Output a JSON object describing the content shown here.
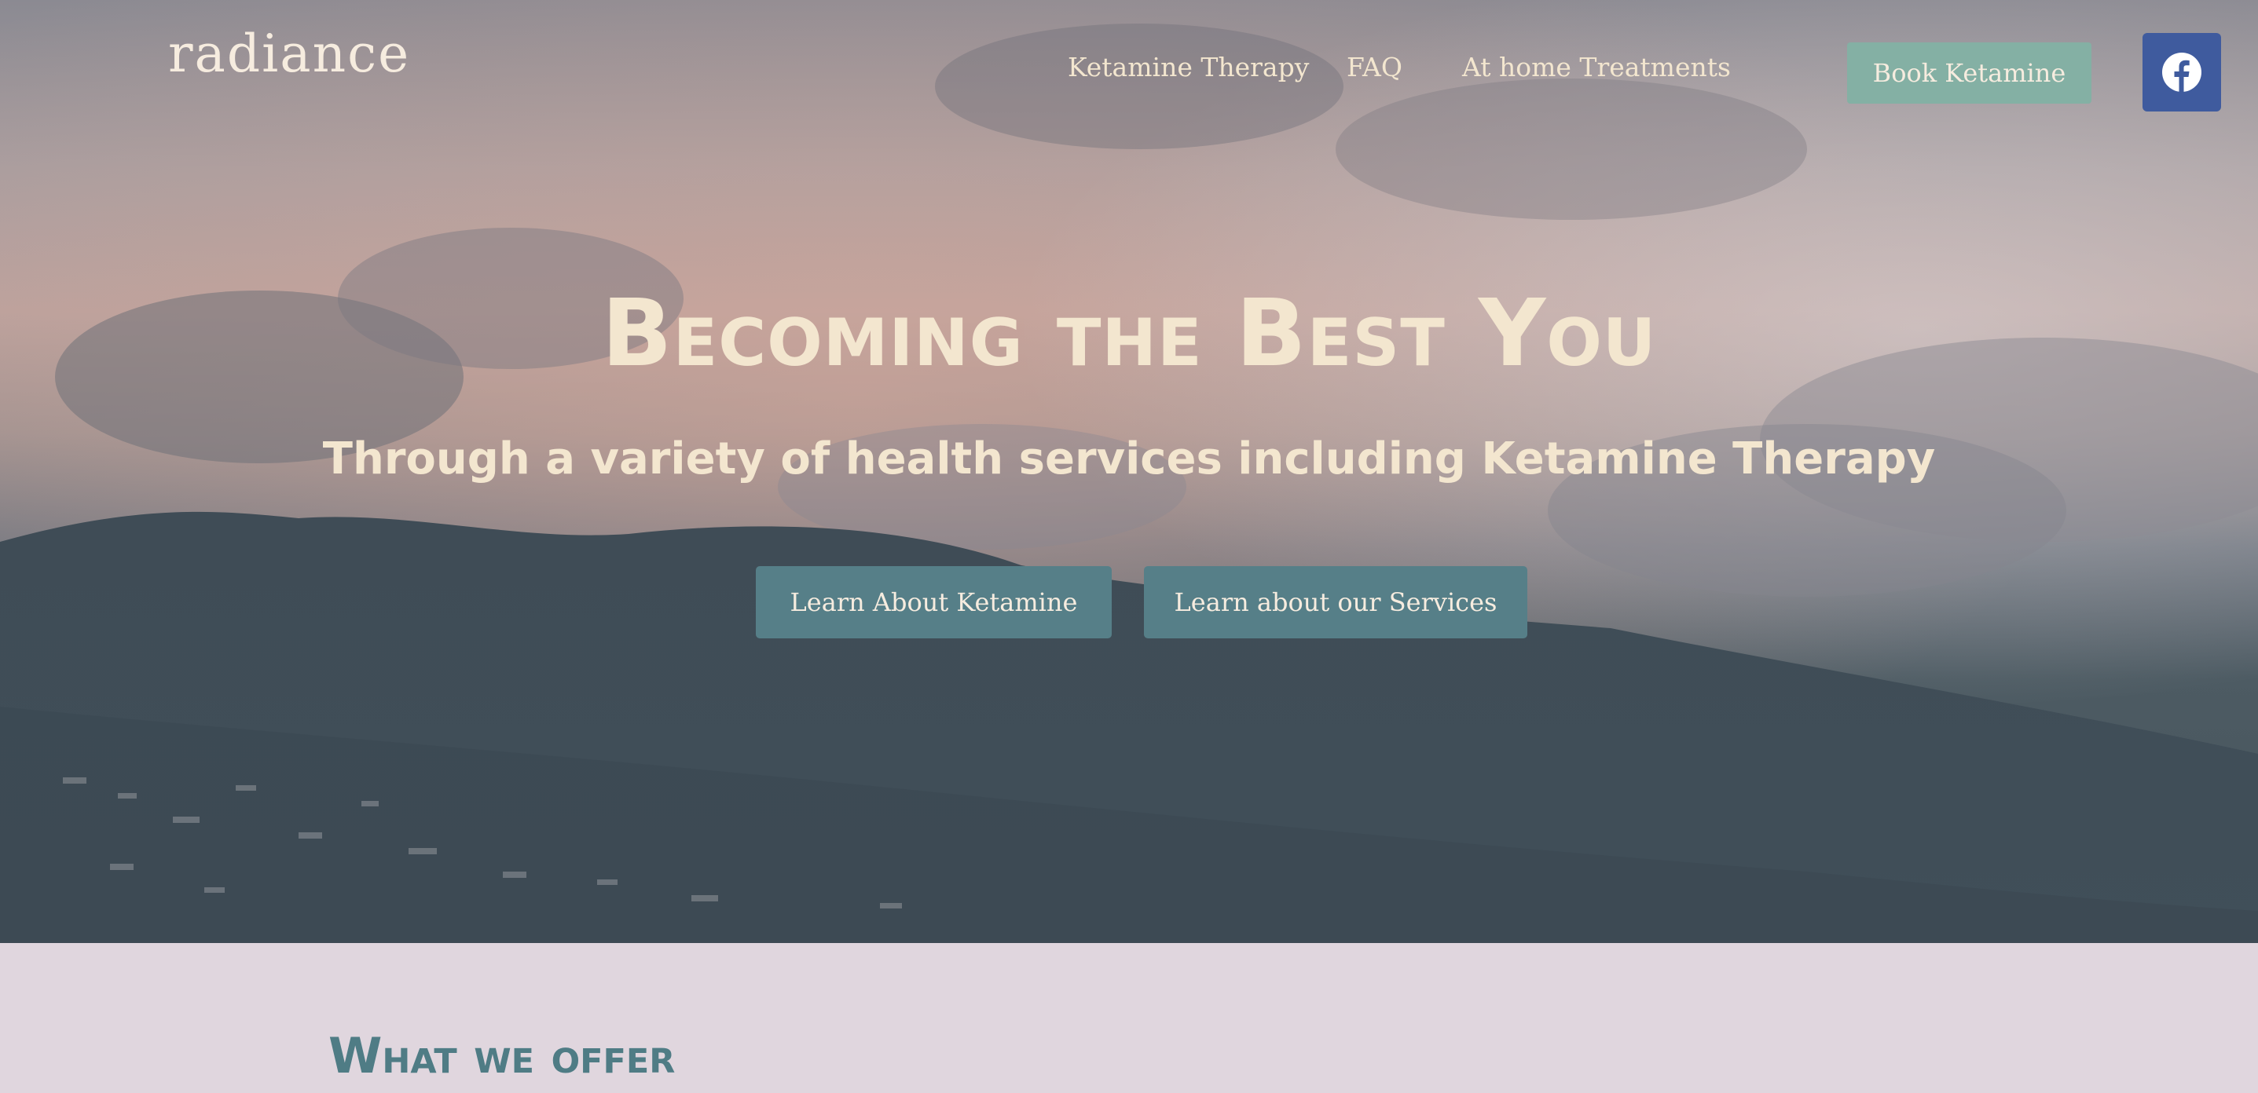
{
  "header": {
    "logo_text": "radiance",
    "nav": [
      {
        "label": "Ketamine Therapy"
      },
      {
        "label": "FAQ"
      },
      {
        "label": "At home Treatments"
      }
    ],
    "book_button_label": "Book Ketamine",
    "social_icon": "facebook-icon"
  },
  "hero": {
    "headline": "Becoming the Best You",
    "subheadline": "Through a variety of health services including Ketamine Therapy",
    "buttons": [
      {
        "label": "Learn About Ketamine"
      },
      {
        "label": "Learn about our Services"
      }
    ]
  },
  "offer": {
    "title": "What we offer"
  },
  "colors": {
    "cream_text": "#f3e6cf",
    "book_button": "#84b0a4",
    "cta_button": "#567f88",
    "facebook": "#3f5b9e",
    "section_bg": "#e0d6de",
    "section_title": "#4f7c85"
  }
}
